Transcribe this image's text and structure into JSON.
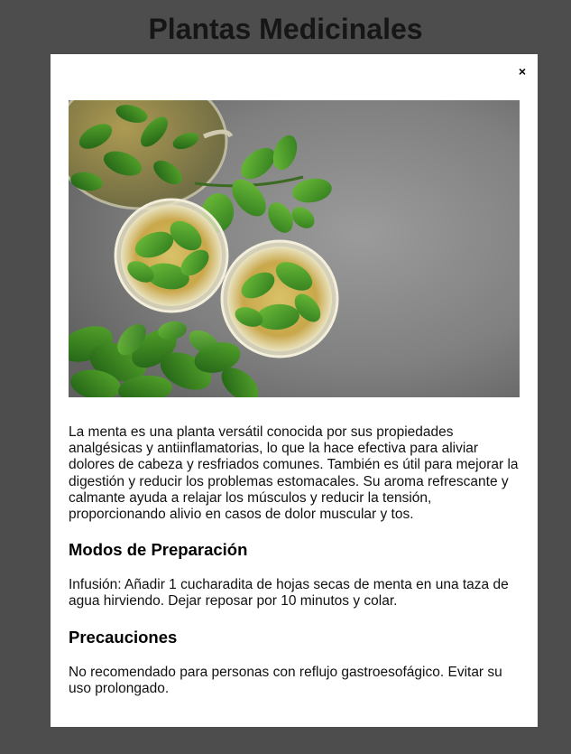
{
  "page": {
    "title": "Plantas Medicinales"
  },
  "modal": {
    "close_label": "×",
    "image": {
      "subject": "mint-tea-photo"
    },
    "description": "La menta es una planta versátil conocida por sus propiedades analgésicas y antiinflamatorias, lo que la hace efectiva para aliviar dolores de cabeza y resfriados comunes. También es útil para mejorar la digestión y reducir los problemas estomacales. Su aroma refrescante y calmante ayuda a relajar los músculos y reducir la tensión, proporcionando alivio en casos de dolor muscular y tos.",
    "preparation": {
      "heading": "Modos de Preparación",
      "text": "Infusión: Añadir 1 cucharadita de hojas secas de menta en una taza de agua hirviendo. Dejar reposar por 10 minutos y colar."
    },
    "precautions": {
      "heading": "Precauciones",
      "text": "No recomendado para personas con reflujo gastroesofágico. Evitar su uso prolongado."
    }
  },
  "colors": {
    "overlay": "#4d4d4d",
    "modal_bg": "#ffffff",
    "title": "#161616"
  }
}
